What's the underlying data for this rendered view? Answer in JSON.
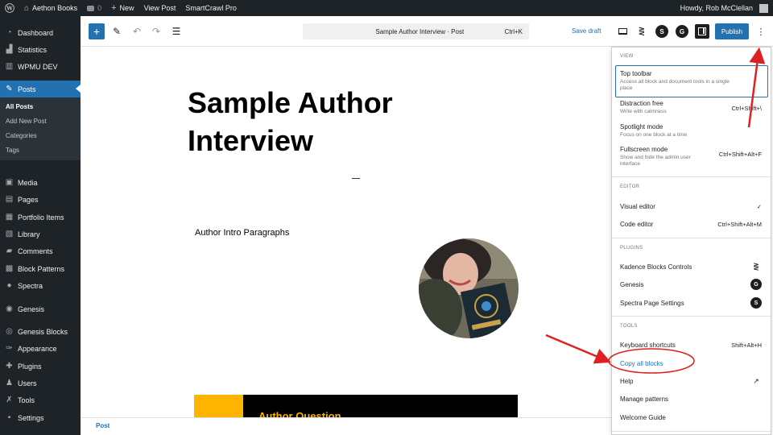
{
  "admin_bar": {
    "site_name": "Aethon Books",
    "comments_count": "0",
    "new_label": "New",
    "view_post": "View Post",
    "plugin": "SmartCrawl Pro",
    "greeting": "Howdy, Rob McClellan"
  },
  "sidebar": {
    "items": [
      {
        "label": "Dashboard",
        "icon": "dashboard-icon"
      },
      {
        "label": "Statistics",
        "icon": "chart-icon"
      },
      {
        "label": "WPMU DEV",
        "icon": "wpmudev-icon"
      },
      {
        "label": "Posts",
        "icon": "pin-icon"
      },
      {
        "label": "Media",
        "icon": "media-icon"
      },
      {
        "label": "Pages",
        "icon": "pages-icon"
      },
      {
        "label": "Portfolio Items",
        "icon": "portfolio-icon"
      },
      {
        "label": "Library",
        "icon": "library-icon"
      },
      {
        "label": "Comments",
        "icon": "comment-icon"
      },
      {
        "label": "Block Patterns",
        "icon": "patterns-icon"
      },
      {
        "label": "Spectra",
        "icon": "spectra-icon"
      },
      {
        "label": "Genesis",
        "icon": "genesis-icon"
      },
      {
        "label": "Genesis Blocks",
        "icon": "genesis-blocks-icon"
      },
      {
        "label": "Appearance",
        "icon": "brush-icon"
      },
      {
        "label": "Plugins",
        "icon": "plugin-icon"
      },
      {
        "label": "Users",
        "icon": "user-icon"
      },
      {
        "label": "Tools",
        "icon": "wrench-icon"
      },
      {
        "label": "Settings",
        "icon": "settings-icon"
      }
    ],
    "submenu": [
      "All Posts",
      "Add New Post",
      "Categories",
      "Tags"
    ]
  },
  "toolbar": {
    "doc_title": "Sample Author Interview · Post",
    "shortcut": "Ctrl+K",
    "save_draft": "Save draft",
    "publish": "Publish"
  },
  "canvas": {
    "post_title": "Sample Author Interview",
    "intro_heading": "Author Intro Paragraphs",
    "question_heading": "Author Question"
  },
  "statusbar": {
    "breadcrumb": "Post"
  },
  "menu": {
    "view": {
      "heading": "VIEW",
      "items": [
        {
          "label": "Top toolbar",
          "desc": "Access all block and document tools in a single place",
          "shortcut": ""
        },
        {
          "label": "Distraction free",
          "desc": "Write with calmness",
          "shortcut": "Ctrl+Shift+\\"
        },
        {
          "label": "Spotlight mode",
          "desc": "Focus on one block at a time",
          "shortcut": ""
        },
        {
          "label": "Fullscreen mode",
          "desc": "Show and hide the admin user interface",
          "shortcut": "Ctrl+Shift+Alt+F"
        }
      ]
    },
    "editor": {
      "heading": "EDITOR",
      "items": [
        {
          "label": "Visual editor",
          "shortcut": "✓"
        },
        {
          "label": "Code editor",
          "shortcut": "Ctrl+Shift+Alt+M"
        }
      ]
    },
    "plugins": {
      "heading": "PLUGINS",
      "items": [
        {
          "label": "Kadence Blocks Controls",
          "icon": "kadence-icon"
        },
        {
          "label": "Genesis",
          "icon": "genesis-icon"
        },
        {
          "label": "Spectra Page Settings",
          "icon": "spectra-icon"
        }
      ]
    },
    "tools": {
      "heading": "TOOLS",
      "items": [
        {
          "label": "Keyboard shortcuts",
          "shortcut": "Shift+Alt+H"
        },
        {
          "label": "Copy all blocks",
          "shortcut": ""
        },
        {
          "label": "Help",
          "shortcut": ""
        },
        {
          "label": "Manage patterns",
          "shortcut": ""
        },
        {
          "label": "Welcome Guide",
          "shortcut": ""
        }
      ]
    }
  },
  "colors": {
    "admin_dark": "#1d2327",
    "accent_blue": "#2271b1",
    "annotation_red": "#e02020",
    "block_yellow": "#ffb400"
  }
}
